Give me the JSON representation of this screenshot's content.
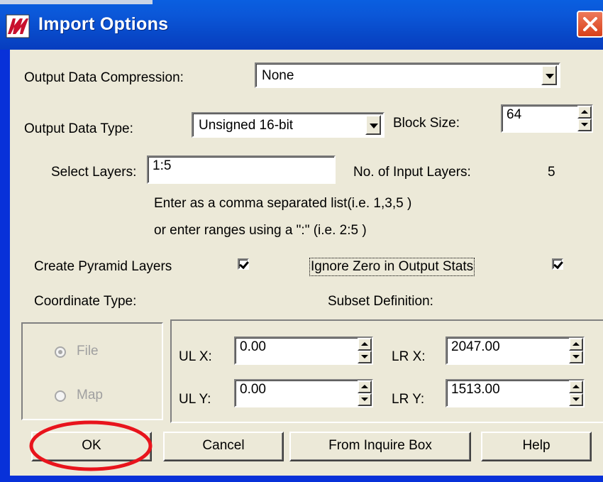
{
  "window": {
    "title": "Import Options"
  },
  "compression": {
    "label": "Output Data Compression:",
    "value": "None"
  },
  "data_type": {
    "label": "Output Data Type:",
    "value": "Unsigned 16-bit"
  },
  "block_size": {
    "label": "Block Size:",
    "value": "64"
  },
  "select_layers": {
    "label": "Select Layers:",
    "value": "1:5"
  },
  "input_layers": {
    "label": "No. of Input Layers:",
    "value": "5"
  },
  "hints": {
    "line1": "Enter as a comma separated list(i.e. 1,3,5 )",
    "line2": "or enter ranges using a \":\" (i.e. 2:5 )"
  },
  "pyramid": {
    "label": "Create Pyramid Layers",
    "checked": true
  },
  "ignore_zero": {
    "label": "Ignore Zero in Output Stats",
    "checked": true
  },
  "coordinate": {
    "label": "Coordinate Type:",
    "options": [
      "File",
      "Map"
    ],
    "selected": "File"
  },
  "subset": {
    "label": "Subset Definition:",
    "ulx_label": "UL X:",
    "ulx": "0.00",
    "uly_label": "UL Y:",
    "uly": "0.00",
    "lrx_label": "LR X:",
    "lrx": "2047.00",
    "lry_label": "LR Y:",
    "lry": "1513.00"
  },
  "buttons": {
    "ok": "OK",
    "cancel": "Cancel",
    "inquire": "From Inquire Box",
    "help": "Help"
  },
  "colors": {
    "titlebar": "#0b57d8",
    "dialog_bg": "#ece9d8",
    "highlight": "#e8141c",
    "close": "#e05a30"
  }
}
